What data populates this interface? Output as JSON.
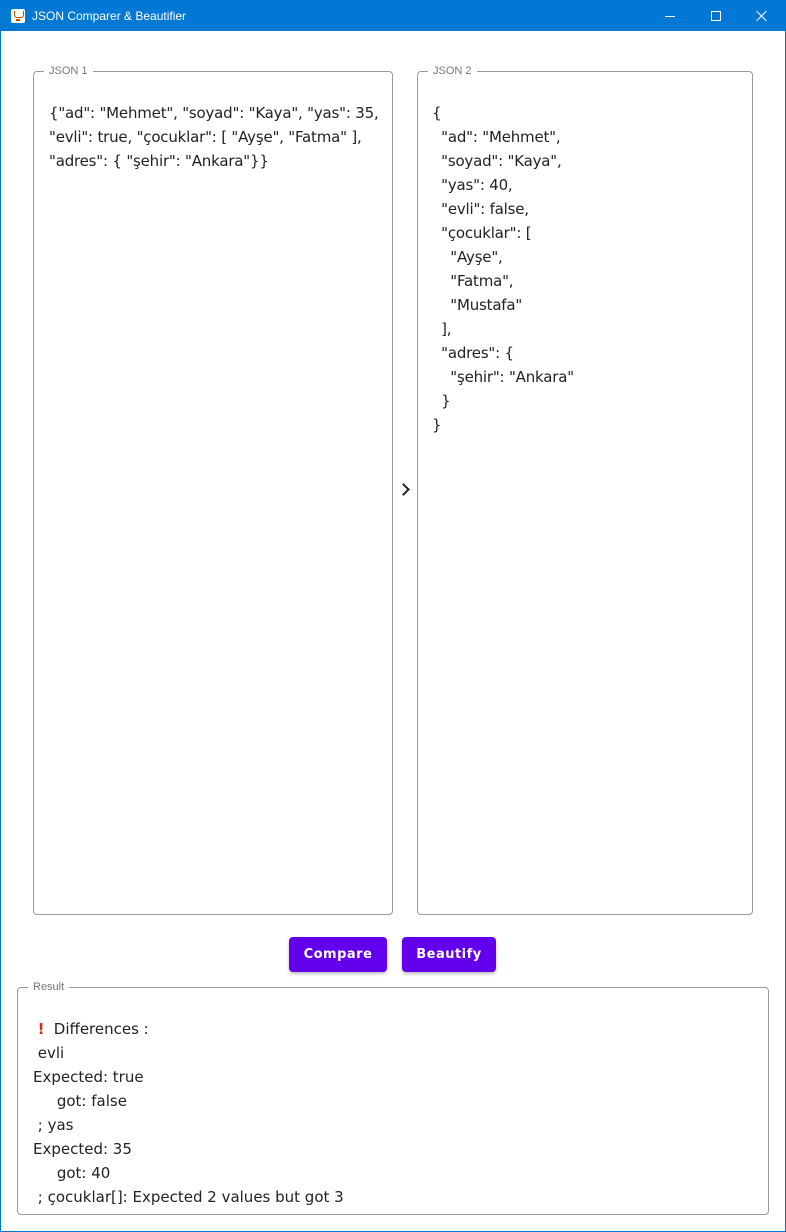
{
  "window": {
    "title": "JSON Comparer & Beautifier",
    "accent": "#0078d4"
  },
  "json1": {
    "legend": "JSON 1",
    "text": "{\"ad\": \"Mehmet\", \"soyad\": \"Kaya\", \"yas\": 35,\n\"evli\": true, \"çocuklar\": [ \"Ayşe\", \"Fatma\" ],\n\"adres\": { \"şehir\": \"Ankara\"}}"
  },
  "json2": {
    "legend": "JSON 2",
    "text": "{\n  \"ad\": \"Mehmet\",\n  \"soyad\": \"Kaya\",\n  \"yas\": 40,\n  \"evli\": false,\n  \"çocuklar\": [\n    \"Ayşe\",\n    \"Fatma\",\n    \"Mustafa\"\n  ],\n  \"adres\": {\n    \"şehir\": \"Ankara\"\n  }\n}"
  },
  "arrow_icon": "chevron-right-icon",
  "buttons": {
    "compare": "Compare",
    "beautify": "Beautify",
    "color": "#6200ee"
  },
  "result": {
    "legend": "Result",
    "icon": "exclamation-icon",
    "heading": " Differences :",
    "body": " evli\nExpected: true\n     got: false\n ; yas\nExpected: 35\n     got: 40\n ; çocuklar[]: Expected 2 values but got 3"
  }
}
